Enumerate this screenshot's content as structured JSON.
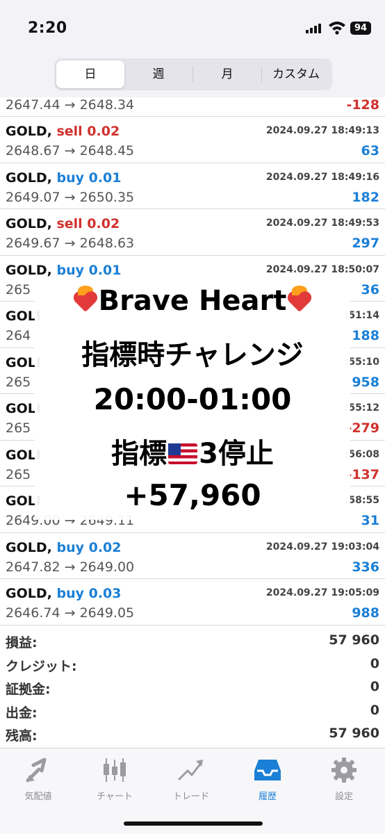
{
  "status": {
    "time": "2:20",
    "battery": "94"
  },
  "tabs": [
    {
      "label": "日"
    },
    {
      "label": "週"
    },
    {
      "label": "月"
    },
    {
      "label": "カスタム"
    }
  ],
  "partial_row": {
    "prices": "2647.44 → 2648.34",
    "profit": "-128"
  },
  "trades": [
    {
      "symbol": "GOLD,",
      "side": "sell 0.02",
      "datetime": "2024.09.27 18:49:13",
      "prices": "2648.67 → 2648.45",
      "profit": "63"
    },
    {
      "symbol": "GOLD,",
      "side": "buy 0.01",
      "datetime": "2024.09.27 18:49:16",
      "prices": "2649.07 → 2650.35",
      "profit": "182"
    },
    {
      "symbol": "GOLD,",
      "side": "sell 0.02",
      "datetime": "2024.09.27 18:49:53",
      "prices": "2649.67 → 2648.63",
      "profit": "297"
    },
    {
      "symbol": "GOLD,",
      "side": "buy 0.01",
      "datetime": "2024.09.27 18:50:07",
      "prices": "265",
      "profit": "36"
    },
    {
      "symbol": "GOLI",
      "side": "",
      "datetime": ":51:14",
      "prices": "264",
      "profit": "188"
    },
    {
      "symbol": "GOLI",
      "side": "",
      "datetime": ":55:10",
      "prices": "265",
      "profit": "958"
    },
    {
      "symbol": "GOLI",
      "side": "",
      "datetime": ":55:12",
      "prices": "265",
      "profit": "-279"
    },
    {
      "symbol": "GOLI",
      "side": "",
      "datetime": ":56:08",
      "prices": "265",
      "profit": "-137"
    },
    {
      "symbol": "GOLI",
      "side": "",
      "datetime": ":58:55",
      "prices": "2649.00 → 2649.11",
      "profit": "31"
    },
    {
      "symbol": "GOLD,",
      "side": "buy 0.02",
      "datetime": "2024.09.27 19:03:04",
      "prices": "2647.82 → 2649.00",
      "profit": "336"
    },
    {
      "symbol": "GOLD,",
      "side": "buy 0.03",
      "datetime": "2024.09.27 19:05:09",
      "prices": "2646.74 → 2649.05",
      "profit": "988"
    }
  ],
  "summary": [
    {
      "label": "損益:",
      "value": "57 960"
    },
    {
      "label": "クレジット:",
      "value": "0"
    },
    {
      "label": "証拠金:",
      "value": "0"
    },
    {
      "label": "出金:",
      "value": "0"
    },
    {
      "label": "残高:",
      "value": "57 960"
    }
  ],
  "overlay": {
    "line1": "Brave Heart",
    "line2": "指標時チャレンジ",
    "line3": "20:00-01:00",
    "line4_pre": "指標",
    "line4_post": "3停止",
    "line5": "+57,960"
  },
  "tabbar": [
    {
      "label": "気配値",
      "icon": "quotes-arrows-icon"
    },
    {
      "label": "チャート",
      "icon": "candlestick-chart-icon"
    },
    {
      "label": "トレード",
      "icon": "trade-trend-icon"
    },
    {
      "label": "履歴",
      "icon": "history-tray-icon"
    },
    {
      "label": "設定",
      "icon": "settings-gear-icon"
    }
  ],
  "colors": {
    "sell": "#d0312d",
    "buy": "#1a7fd6",
    "active_tab": "#1a7fd6"
  }
}
